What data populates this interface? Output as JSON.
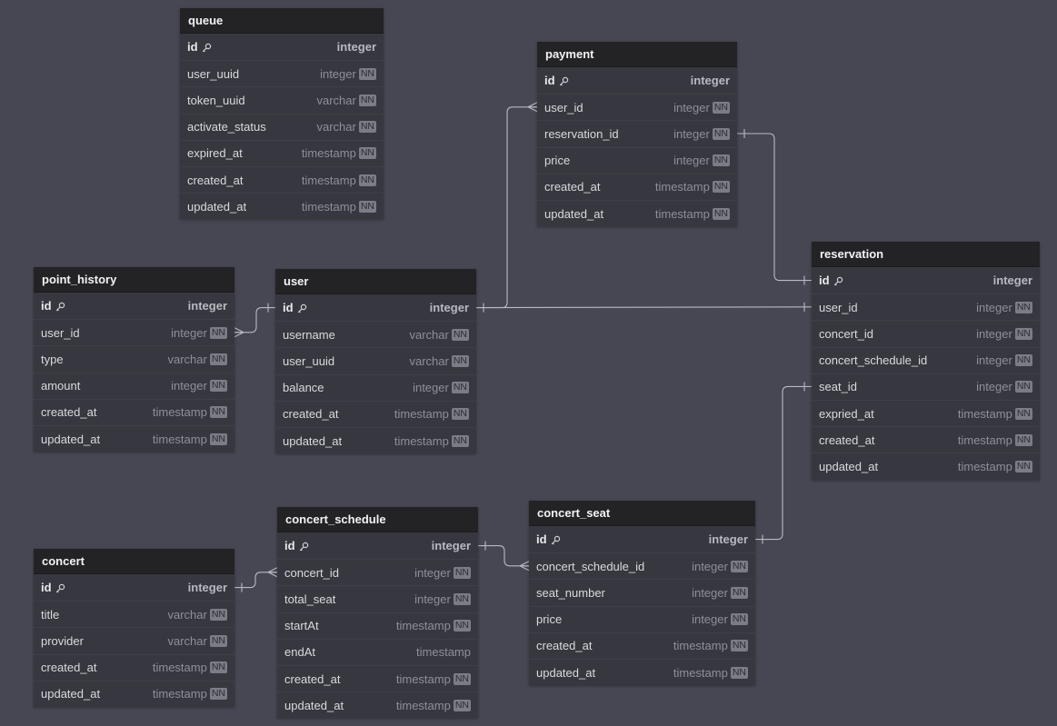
{
  "colors": {
    "background": "#474753",
    "table_body": "#37373f",
    "table_header": "#232326",
    "link": "#b9b9c2"
  },
  "tables": [
    {
      "id": "queue",
      "name": "queue",
      "columns": [
        {
          "name": "id",
          "type": "integer",
          "pk": true,
          "nn": false
        },
        {
          "name": "user_uuid",
          "type": "integer",
          "pk": false,
          "nn": true
        },
        {
          "name": "token_uuid",
          "type": "varchar",
          "pk": false,
          "nn": true
        },
        {
          "name": "activate_status",
          "type": "varchar",
          "pk": false,
          "nn": true
        },
        {
          "name": "expired_at",
          "type": "timestamp",
          "pk": false,
          "nn": true
        },
        {
          "name": "created_at",
          "type": "timestamp",
          "pk": false,
          "nn": true
        },
        {
          "name": "updated_at",
          "type": "timestamp",
          "pk": false,
          "nn": true
        }
      ]
    },
    {
      "id": "payment",
      "name": "payment",
      "columns": [
        {
          "name": "id",
          "type": "integer",
          "pk": true,
          "nn": false
        },
        {
          "name": "user_id",
          "type": "integer",
          "pk": false,
          "nn": true
        },
        {
          "name": "reservation_id",
          "type": "integer",
          "pk": false,
          "nn": true
        },
        {
          "name": "price",
          "type": "integer",
          "pk": false,
          "nn": true
        },
        {
          "name": "created_at",
          "type": "timestamp",
          "pk": false,
          "nn": true
        },
        {
          "name": "updated_at",
          "type": "timestamp",
          "pk": false,
          "nn": true
        }
      ]
    },
    {
      "id": "point_history",
      "name": "point_history",
      "columns": [
        {
          "name": "id",
          "type": "integer",
          "pk": true,
          "nn": false
        },
        {
          "name": "user_id",
          "type": "integer",
          "pk": false,
          "nn": true
        },
        {
          "name": "type",
          "type": "varchar",
          "pk": false,
          "nn": true
        },
        {
          "name": "amount",
          "type": "integer",
          "pk": false,
          "nn": true
        },
        {
          "name": "created_at",
          "type": "timestamp",
          "pk": false,
          "nn": true
        },
        {
          "name": "updated_at",
          "type": "timestamp",
          "pk": false,
          "nn": true
        }
      ]
    },
    {
      "id": "user",
      "name": "user",
      "columns": [
        {
          "name": "id",
          "type": "integer",
          "pk": true,
          "nn": false
        },
        {
          "name": "username",
          "type": "varchar",
          "pk": false,
          "nn": true
        },
        {
          "name": "user_uuid",
          "type": "varchar",
          "pk": false,
          "nn": true
        },
        {
          "name": "balance",
          "type": "integer",
          "pk": false,
          "nn": true
        },
        {
          "name": "created_at",
          "type": "timestamp",
          "pk": false,
          "nn": true
        },
        {
          "name": "updated_at",
          "type": "timestamp",
          "pk": false,
          "nn": true
        }
      ]
    },
    {
      "id": "reservation",
      "name": "reservation",
      "columns": [
        {
          "name": "id",
          "type": "integer",
          "pk": true,
          "nn": false
        },
        {
          "name": "user_id",
          "type": "integer",
          "pk": false,
          "nn": true
        },
        {
          "name": "concert_id",
          "type": "integer",
          "pk": false,
          "nn": true
        },
        {
          "name": "concert_schedule_id",
          "type": "integer",
          "pk": false,
          "nn": true
        },
        {
          "name": "seat_id",
          "type": "integer",
          "pk": false,
          "nn": true
        },
        {
          "name": "expried_at",
          "type": "timestamp",
          "pk": false,
          "nn": true
        },
        {
          "name": "created_at",
          "type": "timestamp",
          "pk": false,
          "nn": true
        },
        {
          "name": "updated_at",
          "type": "timestamp",
          "pk": false,
          "nn": true
        }
      ]
    },
    {
      "id": "concert_schedule",
      "name": "concert_schedule",
      "columns": [
        {
          "name": "id",
          "type": "integer",
          "pk": true,
          "nn": false
        },
        {
          "name": "concert_id",
          "type": "integer",
          "pk": false,
          "nn": true
        },
        {
          "name": "total_seat",
          "type": "integer",
          "pk": false,
          "nn": true
        },
        {
          "name": "startAt",
          "type": "timestamp",
          "pk": false,
          "nn": true
        },
        {
          "name": "endAt",
          "type": "timestamp",
          "pk": false,
          "nn": false
        },
        {
          "name": "created_at",
          "type": "timestamp",
          "pk": false,
          "nn": true
        },
        {
          "name": "updated_at",
          "type": "timestamp",
          "pk": false,
          "nn": true
        }
      ]
    },
    {
      "id": "concert_seat",
      "name": "concert_seat",
      "columns": [
        {
          "name": "id",
          "type": "integer",
          "pk": true,
          "nn": false
        },
        {
          "name": "concert_schedule_id",
          "type": "integer",
          "pk": false,
          "nn": true
        },
        {
          "name": "seat_number",
          "type": "integer",
          "pk": false,
          "nn": true
        },
        {
          "name": "price",
          "type": "integer",
          "pk": false,
          "nn": true
        },
        {
          "name": "created_at",
          "type": "timestamp",
          "pk": false,
          "nn": true
        },
        {
          "name": "updated_at",
          "type": "timestamp",
          "pk": false,
          "nn": true
        }
      ]
    },
    {
      "id": "concert",
      "name": "concert",
      "columns": [
        {
          "name": "id",
          "type": "integer",
          "pk": true,
          "nn": false
        },
        {
          "name": "title",
          "type": "varchar",
          "pk": false,
          "nn": true
        },
        {
          "name": "provider",
          "type": "varchar",
          "pk": false,
          "nn": true
        },
        {
          "name": "created_at",
          "type": "timestamp",
          "pk": false,
          "nn": true
        },
        {
          "name": "updated_at",
          "type": "timestamp",
          "pk": false,
          "nn": true
        }
      ]
    }
  ],
  "nn_label": "NN",
  "relationships": [
    {
      "from": "user.id",
      "to": "point_history.user_id",
      "kind": "one-to-many"
    },
    {
      "from": "user.id",
      "to": "payment.user_id",
      "kind": "one-to-many"
    },
    {
      "from": "user.id",
      "to": "reservation.user_id",
      "kind": "one-to-one"
    },
    {
      "from": "payment.reservation_id",
      "to": "reservation.id",
      "kind": "one-to-one"
    },
    {
      "from": "concert_seat.id",
      "to": "reservation.seat_id",
      "kind": "one-to-one"
    },
    {
      "from": "concert.id",
      "to": "concert_schedule.concert_id",
      "kind": "one-to-many"
    },
    {
      "from": "concert_schedule.id",
      "to": "concert_seat.concert_schedule_id",
      "kind": "one-to-many"
    }
  ]
}
